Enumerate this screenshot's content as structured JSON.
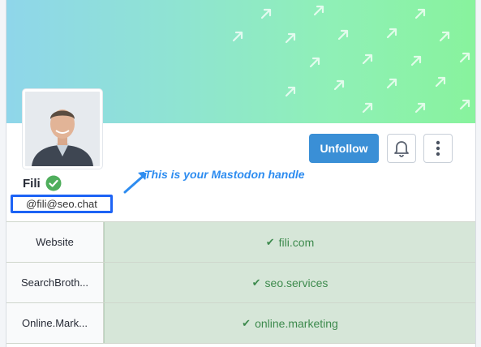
{
  "colors": {
    "accent": "#3a8fd6",
    "verified": "#4fae5c",
    "annotation": "#2d8cf0",
    "highlight_border": "#1d63f5",
    "field_verified_bg": "#d6e6d8",
    "field_verified_text": "#3d8a4d"
  },
  "profile": {
    "display_name": "Fili",
    "handle": "@fili@seo.chat",
    "verified_icon": "check-circle-icon"
  },
  "actions": {
    "unfollow_label": "Unfollow",
    "bell_icon": "bell-icon",
    "more_icon": "vertical-ellipsis-icon"
  },
  "annotation": {
    "text": "This is your Mastodon handle"
  },
  "fields": [
    {
      "name": "Website",
      "value": "fili.com"
    },
    {
      "name": "SearchBroth...",
      "value": "seo.services"
    },
    {
      "name": "Online.Mark...",
      "value": "online.marketing"
    }
  ]
}
